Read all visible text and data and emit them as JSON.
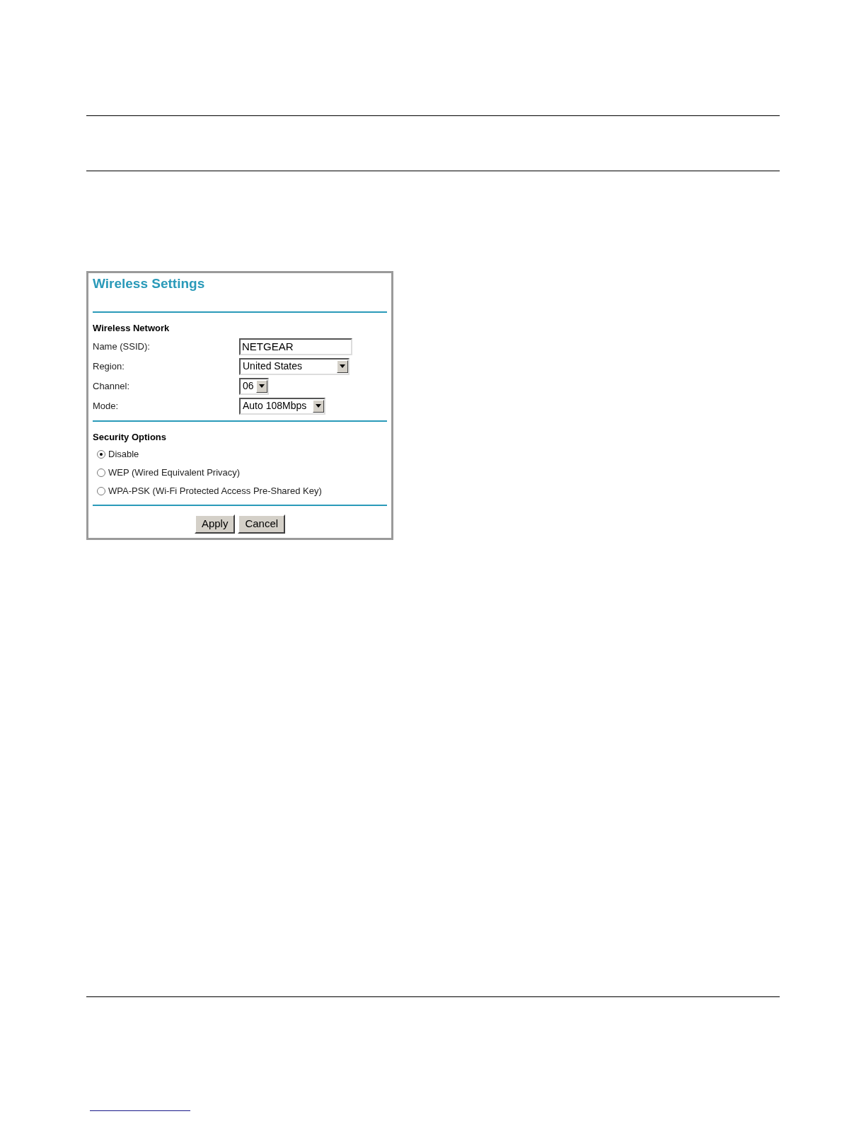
{
  "panel": {
    "title": "Wireless Settings",
    "network": {
      "heading": "Wireless Network",
      "fields": [
        {
          "kind": "text",
          "label": "Name (SSID):",
          "value": "NETGEAR"
        },
        {
          "kind": "select",
          "label": "Region:",
          "value": "United States"
        },
        {
          "kind": "select",
          "label": "Channel:",
          "value": "06"
        },
        {
          "kind": "select",
          "label": "Mode:",
          "value": "Auto 108Mbps"
        }
      ]
    },
    "security": {
      "heading": "Security Options",
      "options": [
        {
          "label": "Disable",
          "selected": true
        },
        {
          "label": "WEP (Wired Equivalent Privacy)",
          "selected": false
        },
        {
          "label": "WPA-PSK (Wi-Fi Protected Access Pre-Shared Key)",
          "selected": false
        }
      ]
    },
    "buttons": [
      "Apply",
      "Cancel"
    ]
  }
}
